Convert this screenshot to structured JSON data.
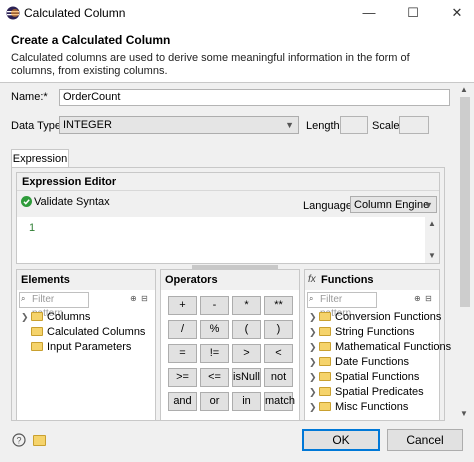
{
  "window": {
    "title": "Calculated Column",
    "minimize": "—",
    "maximize": "☐",
    "close": "✕"
  },
  "header": {
    "title": "Create a Calculated Column",
    "description": "Calculated columns are used to derive some meaningful information in the form of columns, from existing columns."
  },
  "form": {
    "name_label": "Name:*",
    "name_value": "OrderCount",
    "datatype_label": "Data Type:",
    "datatype_value": "INTEGER",
    "length_label": "Length:",
    "length_value": "",
    "scale_label": "Scale:",
    "scale_value": ""
  },
  "tabs": {
    "expression": "Expression"
  },
  "expression_editor": {
    "title": "Expression Editor",
    "validate": "Validate Syntax",
    "language_label": "Language:",
    "language_value": "Column Engine",
    "line_number": "1"
  },
  "elements": {
    "title": "Elements",
    "filter_placeholder": "Filter pattern",
    "items": [
      {
        "label": "Columns"
      },
      {
        "label": "Calculated Columns"
      },
      {
        "label": "Input Parameters"
      }
    ]
  },
  "operators": {
    "title": "Operators",
    "rows": [
      [
        "+",
        "-",
        "*",
        "**"
      ],
      [
        "/",
        "%",
        "(",
        ")"
      ],
      [
        "=",
        "!=",
        ">",
        "<"
      ],
      [
        ">=",
        "<=",
        "isNull",
        "not"
      ],
      [
        "and",
        "or",
        "in",
        "match"
      ]
    ]
  },
  "functions": {
    "title": "Functions",
    "filter_placeholder": "Filter pattern",
    "items": [
      {
        "label": "Conversion Functions"
      },
      {
        "label": "String Functions"
      },
      {
        "label": "Mathematical Functions"
      },
      {
        "label": "Date Functions"
      },
      {
        "label": "Spatial Functions"
      },
      {
        "label": "Spatial Predicates"
      },
      {
        "label": "Misc Functions"
      }
    ]
  },
  "footer": {
    "ok": "OK",
    "cancel": "Cancel"
  },
  "colors": {
    "accent": "#0078d7",
    "validate_green": "#2e9b3a",
    "folder": "#f5d36b"
  }
}
